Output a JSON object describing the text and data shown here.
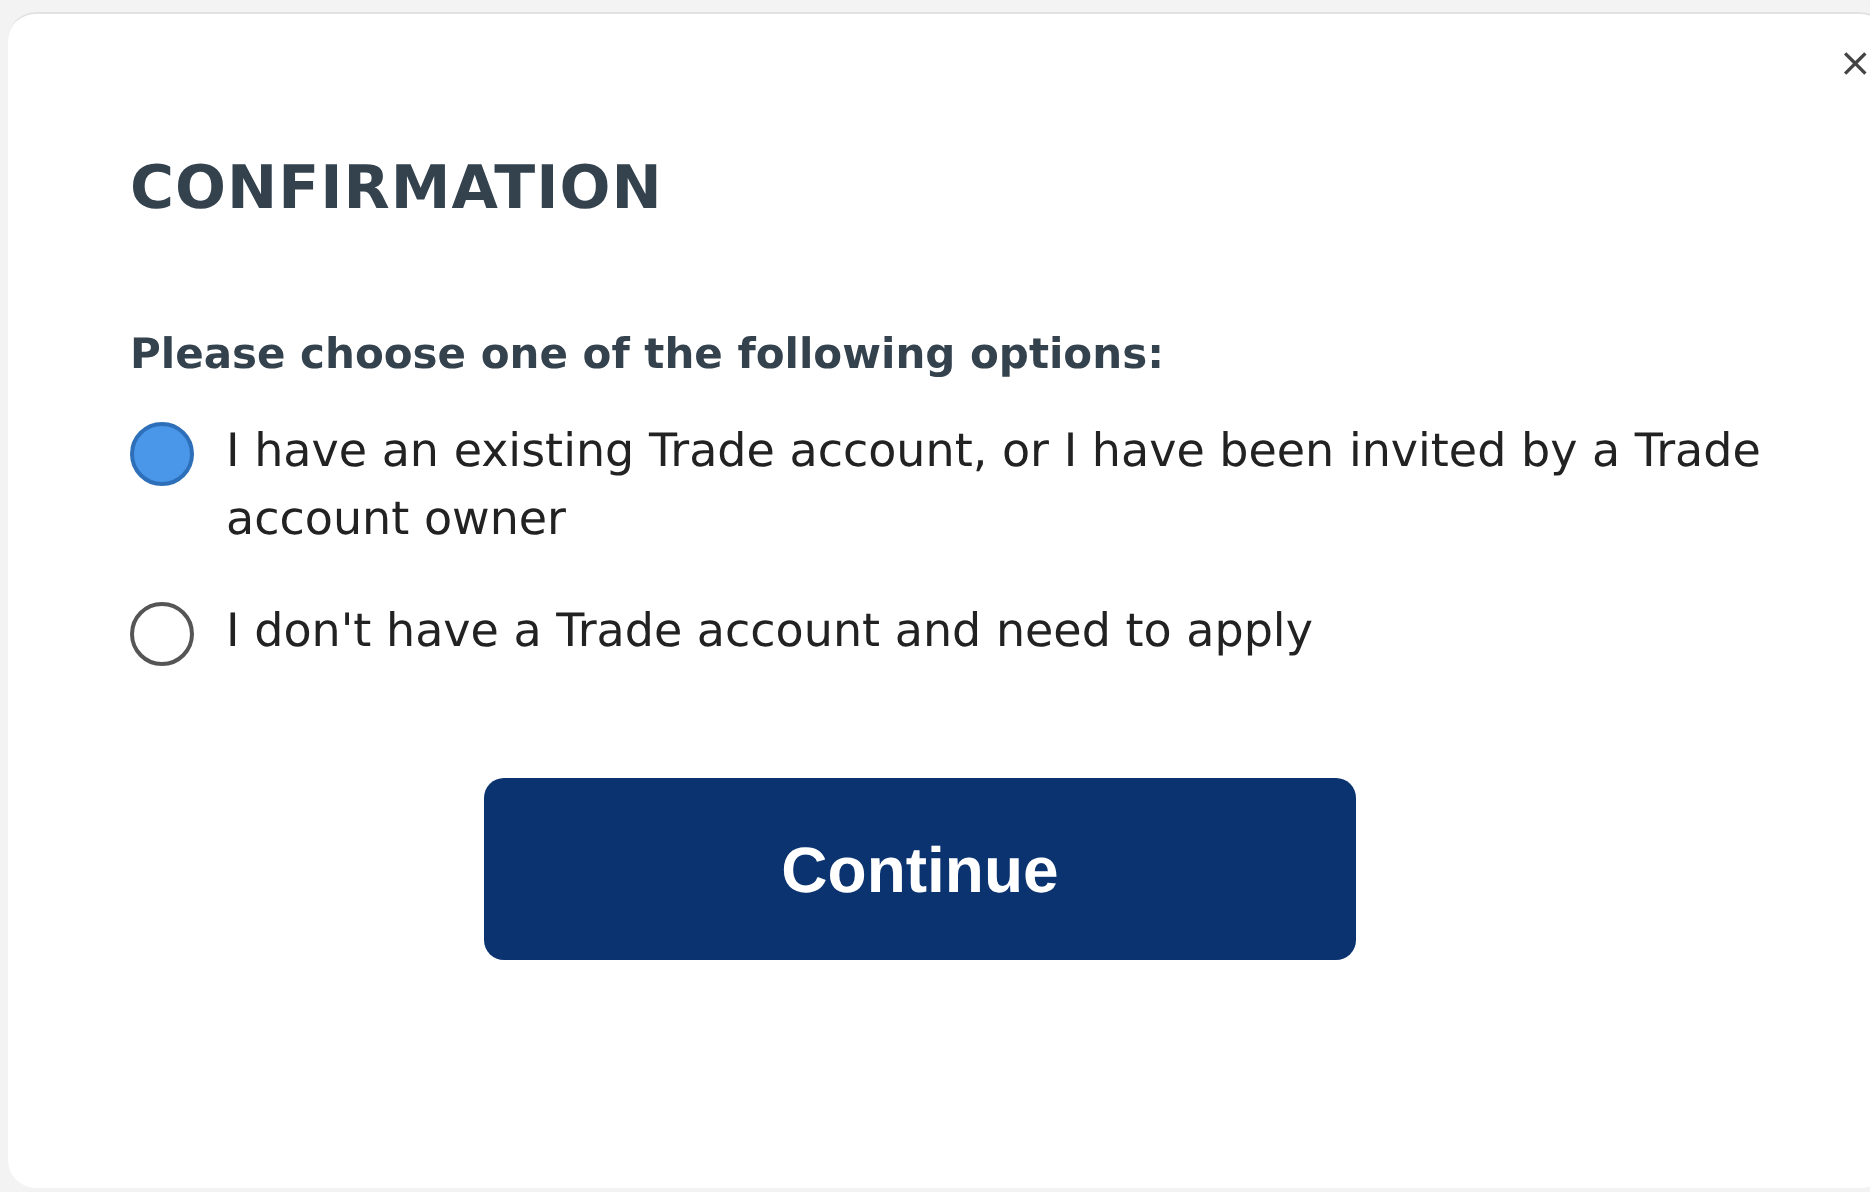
{
  "dialog": {
    "close": "×",
    "title": "CONFIRMATION",
    "prompt": "Please choose one of the following options:",
    "options": [
      {
        "label": "I have an existing Trade account, or I have been invited by a Trade account owner",
        "selected": true
      },
      {
        "label": "I don't have a Trade account and need to apply",
        "selected": false
      }
    ],
    "button": "Continue"
  }
}
